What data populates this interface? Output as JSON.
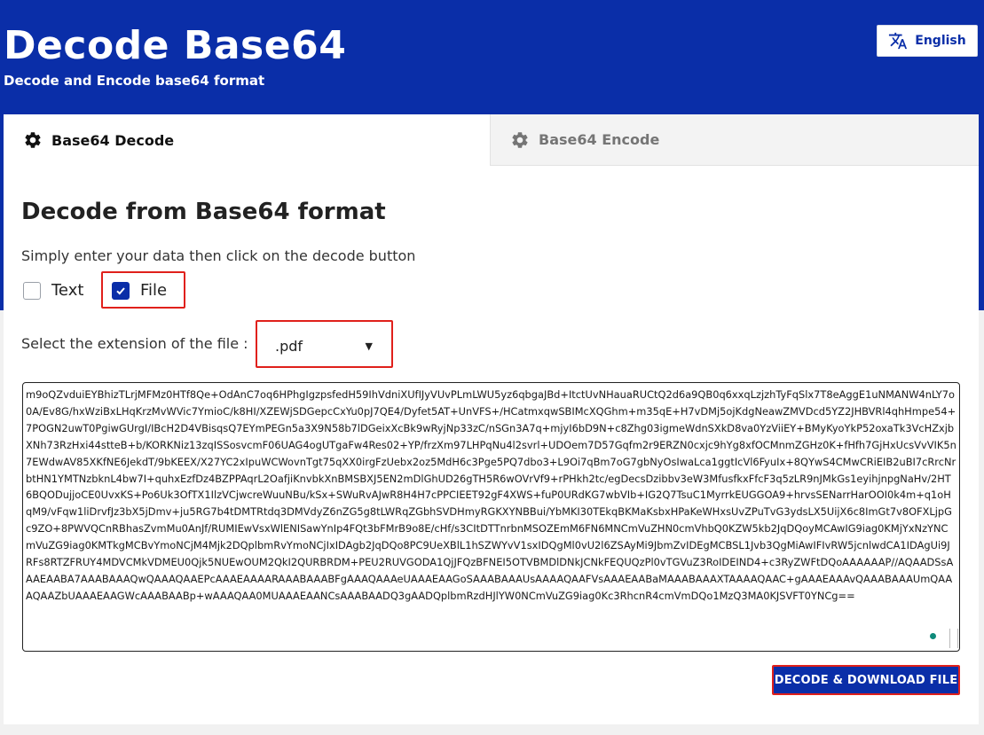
{
  "header": {
    "title": "Decode Base64",
    "subtitle": "Decode and Encode base64 format",
    "language_label": "English"
  },
  "tabs": [
    {
      "label": "Base64 Decode",
      "icon": "gear-icon",
      "active": true
    },
    {
      "label": "Base64 Encode",
      "icon": "gear-icon",
      "active": false
    }
  ],
  "main": {
    "title": "Decode from Base64 format",
    "instruction": "Simply enter your data then click on the decode button",
    "options": {
      "text_label": "Text",
      "text_checked": false,
      "file_label": "File",
      "file_checked": true
    },
    "extension_label": "Select the extension of the file :",
    "extension_value": ".pdf",
    "input_value": "m9oQZvduiEYBhizTLrjMFMz0HTf8Qe+OdAnC7oq6HPhgIgzpsfedH59IhVdniXUfIJyVUvPLmLWU5yz6qbgaJBd+ItctUvNHauaRUCtQ2d6a9QB0q6xxqLzjzhTyFqSlx7T8eAggE1uNMANW4nLY7o0A/Ev8G/hxWziBxLHqKrzMvWVic7YmioC/k8HI/XZEWjSDGepcCxYu0pJ7QE4/Dyfet5AT+UnVFS+/HCatmxqwSBIMcXQGhm+m35qE+H7vDMj5ojKdgNeawZMVDcd5YZ2JHBVRl4qhHmpe54+7POGN2uwT0PgiwGUrgI/IBcH2D4VBisqsQ7EYmPEGn5a3X9N58b7lDGeixXcBk9wRyjNp33zC/nSGn3A7q+mjyI6bD9N+c8Zhg03igmeWdnSXkD8va0YzViiEY+BMyKyoYkP52oxaTk3VcHZxjbXNh73RzHxi44stteB+b/KORKNiz13zqISSosvcmF06UAG4ogUTgaFw4Res02+YP/frzXm97LHPqNu4l2svrl+UDOem7D57Gqfm2r9ERZN0cxjc9hYg8xfOCMnmZGHz0K+fHfh7GjHxUcsVvVIK5n7EWdwAV85XKfNE6JekdT/9bKEEX/X27YC2xIpuWCWovnTgt75qXX0irgFzUebx2oz5MdH6c3Pge5PQ7dbo3+L9Oi7qBm7oG7gbNyOsIwaLca1ggtIcVl6FyuIx+8QYwS4CMwCRiEIB2uBI7cRrcNrbtHN1YMTNzbknL4bw7I+quhxEzfDz4BZPPAqrL2OafjiKnvbkXnBMSBXJ5EN2mDlGhUD26gTH5R6wOVrVf9+rPHkh2tc/egDecsDzibbv3eW3MfusfkxFfcF3q5zLR9nJMkGs1eyihjnpgNaHv/2HT6BQODujjoCE0UvxKS+Po6Uk3OfTX1IlzVCjwcreWuuNBu/kSx+SWuRvAJwR8H4H7cPPCIEET92gF4XWS+fuP0URdKG7wbVIb+IG2Q7TsuC1MyrrkEUGGOA9+hrvsSENarrHarOOI0k4m+q1oHqM9/vFqw1liDrvfJz3bX5jDmv+ju5RG7b4tDMTRtdq3DMVdyZ6nZG5g8tLWRqZGbhSVDHmyRGKXYNBBui/YbMKI30TEkqBKMaKsbxHPaKeWHxsUvZPuTvG3ydsLX5UijX6c8ImGt7v8OFXLjpGc9ZO+8PWVQCnRBhasZvmMu0AnJf/RUMIEwVsxWlENISawYnIp4FQt3bFMrB9o8E/cHf/s3CItDTTnrbnMSOZEmM6FN6MNCmVuZHN0cmVhbQ0KZW5kb2JqDQoyMCAwIG9iag0KMjYxNzYNCmVuZG9iag0KMTkgMCBvYmoNCjM4Mjk2DQplbmRvYmoNCjIxIDAgb2JqDQo8PC9UeXBlL1hSZWYvV1sxIDQgMl0vU2l6ZSAyMi9JbmZvIDEgMCBSL1Jvb3QgMiAwIFIvRW5jcnlwdCA1IDAgUi9JRFs8RTZFRUY4MDVCMkVDMEU0Qjk5NUEwOUM2QkI2QURBRDM+PEU2RUVGODA1QjJFQzBFNEI5OTVBMDlDNkJCNkFEQUQzPl0vTGVuZ3RoIDEIND4+c3RyZWFtDQoAAAAAAP//AQAADSsAAAEAABA7AAABAAAQwQAAAQAAEPcAAAEAAAARAAABAAABFgAAAQAAAeUAAAEAAGoSAAABAAAUsAAAAQAAFVsAAAEAABaMAAABAAAXTAAAAQAAC+gAAAEAAAvQAAABAAAUmQAAAQAAZbUAAAEAAGWcAAABAABp+wAAAQAA0MUAAAEAANCsAAABAADQ3gAADQplbmRzdHJlYW0NCmVuZG9iag0Kc3RhcnR4cmVmDQo1MzQ3MA0KJSVFT0YNCg=="
  },
  "actions": {
    "submit_label": "DECODE & DOWNLOAD FILE"
  },
  "colors": {
    "brand": "#0a2ea8",
    "highlight": "#e0201b"
  }
}
